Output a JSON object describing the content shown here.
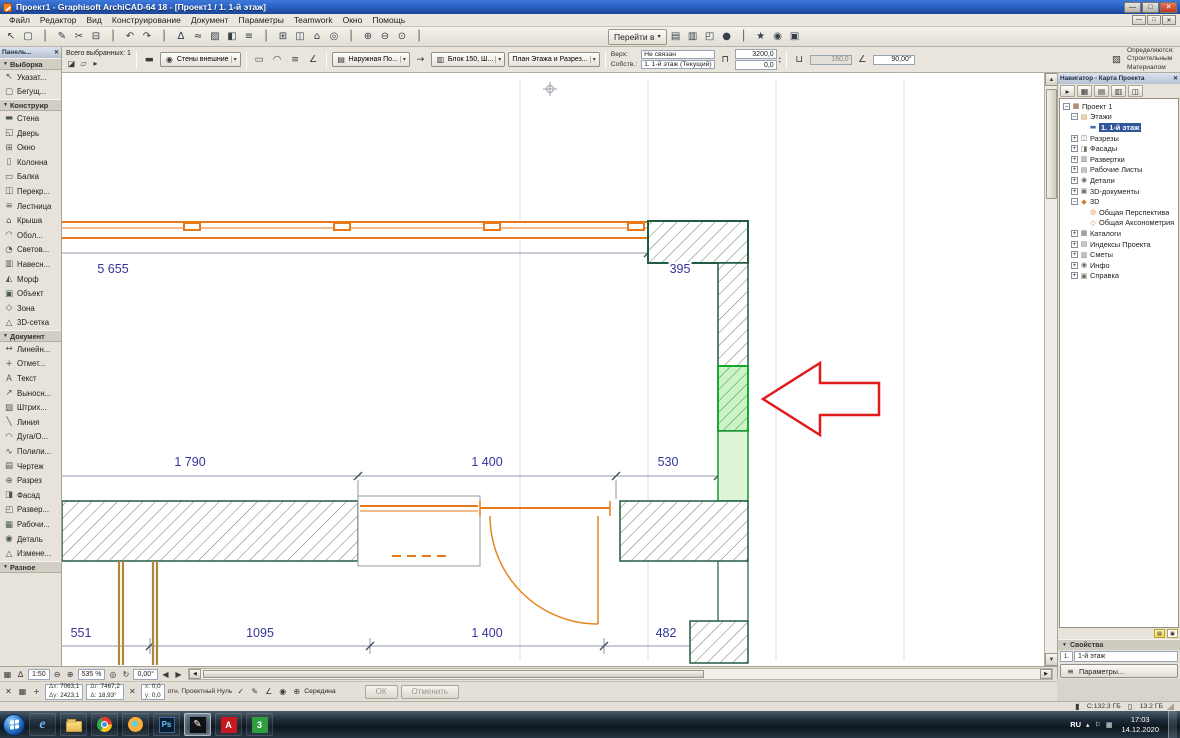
{
  "colors": {
    "titlebar_blue": "#2a63c8",
    "wall_green": "#225c40",
    "selection_green": "#17a832",
    "element_orange": "#e87818",
    "dim_blue": "#35359b",
    "arrow_red": "#e11a1a"
  },
  "titlebar": {
    "title": "Проект1 - Graphisoft ArchiCAD-64 18 - [Проект1 / 1. 1-й этаж]"
  },
  "menubar": {
    "items": [
      "Файл",
      "Редактор",
      "Вид",
      "Конструирование",
      "Документ",
      "Параметры",
      "Teamwork",
      "Окно",
      "Помощь"
    ]
  },
  "toolbar": {
    "icons_left": [
      "↖",
      "▢",
      "│",
      "✎",
      "✂",
      "⊟",
      "│",
      "↶",
      "↷",
      "│",
      "∆",
      "≈",
      "▨",
      "◧",
      "≡",
      "│",
      "⊞",
      "◫",
      "⌂",
      "◎",
      "│",
      "⊕",
      "⊖",
      "⊙",
      "│"
    ],
    "goto": "Перейти в",
    "icons_right": [
      "▤",
      "▥",
      "◰",
      "●",
      "│",
      "★",
      "◉",
      "▣"
    ]
  },
  "infobox": {
    "selected_count": "Всего выбранных: 1",
    "favorite": "Стены внешние",
    "composite": "Наружная По...",
    "block": "Блок 150, Ш...",
    "display": "План Этажа и Разрез...",
    "top_label": "Верх:",
    "top_value": "Не связан",
    "own_label": "Собств.:",
    "own_value": "1. 1-й этаж (Текущий)",
    "height_top": "3200,0",
    "height_bottom": "0,0",
    "offset": "160,0",
    "angle": "90,00°",
    "note_line1": "Определяются:",
    "note_line2": "Строительным",
    "note_line3": "Материалом"
  },
  "toolbox": {
    "title": "Панель...",
    "sections": [
      {
        "label": "Выборка",
        "items": [
          {
            "glyph": "↖",
            "label": "Указат..."
          },
          {
            "glyph": "▢",
            "label": "Бегущ..."
          }
        ]
      },
      {
        "label": "Конструир",
        "items": [
          {
            "glyph": "▬",
            "label": "Стена"
          },
          {
            "glyph": "◱",
            "label": "Дверь"
          },
          {
            "glyph": "⊞",
            "label": "Окно"
          },
          {
            "glyph": "▯",
            "label": "Колонна"
          },
          {
            "glyph": "▭",
            "label": "Балка"
          },
          {
            "glyph": "◫",
            "label": "Перекр..."
          },
          {
            "glyph": "≡",
            "label": "Лестница"
          },
          {
            "glyph": "⌂",
            "label": "Крыша"
          },
          {
            "glyph": "◠",
            "label": "Обол..."
          },
          {
            "glyph": "◔",
            "label": "Светов..."
          },
          {
            "glyph": "▥",
            "label": "Навесн..."
          },
          {
            "glyph": "◭",
            "label": "Морф"
          },
          {
            "glyph": "▣",
            "label": "Объект"
          },
          {
            "glyph": "◇",
            "label": "Зона"
          },
          {
            "glyph": "△",
            "label": "3D-сетка"
          }
        ]
      },
      {
        "label": "Документ",
        "items": [
          {
            "glyph": "↔",
            "label": "Линейн..."
          },
          {
            "glyph": "+",
            "label": "Отмет..."
          },
          {
            "glyph": "A",
            "label": "Текст"
          },
          {
            "glyph": "↗",
            "label": "Выносн..."
          },
          {
            "glyph": "▨",
            "label": "Штрих..."
          },
          {
            "glyph": "╲",
            "label": "Линия"
          },
          {
            "glyph": "◠",
            "label": "Дуга/О..."
          },
          {
            "glyph": "∿",
            "label": "Полили..."
          },
          {
            "glyph": "▤",
            "label": "Чертеж"
          },
          {
            "glyph": "⊕",
            "label": "Разрез"
          },
          {
            "glyph": "◨",
            "label": "Фасад"
          },
          {
            "glyph": "◰",
            "label": "Развер..."
          },
          {
            "glyph": "▦",
            "label": "Рабочи..."
          },
          {
            "glyph": "◉",
            "label": "Деталь"
          },
          {
            "glyph": "△",
            "label": "Измене..."
          }
        ]
      },
      {
        "label": "Разное",
        "items": []
      }
    ]
  },
  "canvas": {
    "dims": [
      "5 655",
      "395",
      "1 790",
      "1 400",
      "530",
      "551",
      "1095",
      "1 400",
      "482"
    ]
  },
  "navigator": {
    "title": "Навигатор - Карта Проекта",
    "tree": [
      "Проект 1",
      "Этажи",
      "1. 1-й этаж",
      "Разрезы",
      "Фасады",
      "Развертки",
      "Рабочие Листы",
      "Детали",
      "3D-документы",
      "3D",
      "Общая Перспектива",
      "Общая Аксонометрия",
      "Каталоги",
      "Индексы Проекта",
      "Сметы",
      "Инфо",
      "Справка"
    ],
    "props_header": "Свойства",
    "floor_label": "1-й этаж",
    "settings_button": "Параметры..."
  },
  "bottombar": {
    "scale": "1:50",
    "zoom": "535 %",
    "rotation": "0,00°",
    "dx_label": "Δх:",
    "dx": "7063,1",
    "dy_label": "Δу:",
    "dy": "2423,1",
    "dr_label": "Δг:",
    "dr": "7467,2",
    "da_label": "Δ:",
    "da": "18,93°",
    "x_label": "х:",
    "x": "0,0",
    "y_label": "у:",
    "y": "0,0",
    "origin": "отн. Проектный Нуль",
    "snap": "Середина",
    "ok": "ОК",
    "cancel": "Отменить"
  },
  "statusstrip": {
    "disk": "С:132.3 ГБ",
    "memory": "13.2 ГБ"
  },
  "taskbar": {
    "ie_glyph": "e",
    "ps_glyph": "Ps",
    "acrobat_glyph": "A",
    "green_glyph": "3",
    "lang": "RU",
    "time": "17:03",
    "date": "14.12.2020"
  }
}
